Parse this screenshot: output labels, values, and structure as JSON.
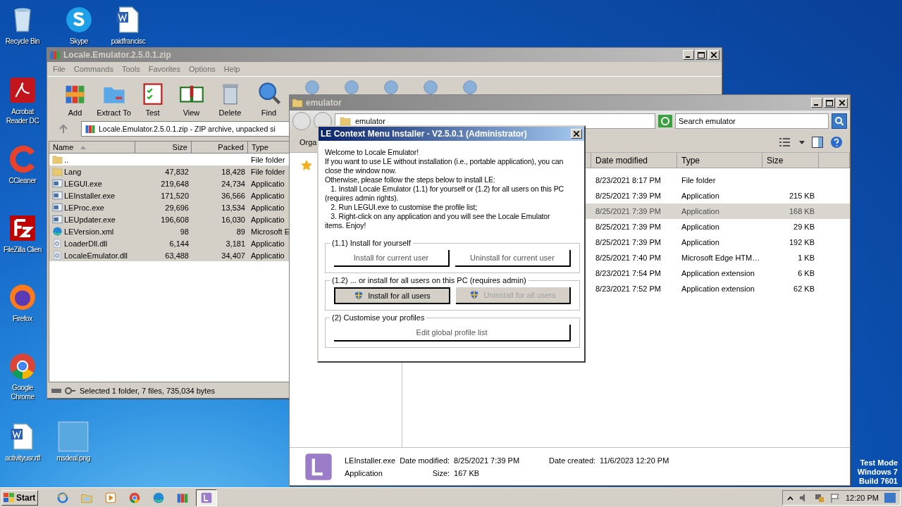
{
  "desktop_icons": [
    {
      "label": "Recycle Bin",
      "kind": "recycle"
    },
    {
      "label": "Skype",
      "kind": "skype"
    },
    {
      "label": "paidfrancisc",
      "kind": "word"
    },
    {
      "label": "Acrobat Reader DC",
      "kind": "acrobat"
    },
    {
      "label": "CCleaner",
      "kind": "ccleaner"
    },
    {
      "label": "FileZilla Clien",
      "kind": "filezilla"
    },
    {
      "label": "Firefox",
      "kind": "firefox"
    },
    {
      "label": "Google Chrome",
      "kind": "chrome"
    },
    {
      "label": "activityusr.rtf",
      "kind": "word"
    },
    {
      "label": "msdeal.png",
      "kind": "blank"
    }
  ],
  "winrar": {
    "title": "Locale.Emulator.2.5.0.1.zip",
    "menu": [
      "File",
      "Commands",
      "Tools",
      "Favorites",
      "Options",
      "Help"
    ],
    "toolbar": [
      {
        "label": "Add",
        "kind": "add"
      },
      {
        "label": "Extract To",
        "kind": "extract"
      },
      {
        "label": "Test",
        "kind": "test"
      },
      {
        "label": "View",
        "kind": "view"
      },
      {
        "label": "Delete",
        "kind": "delete"
      },
      {
        "label": "Find",
        "kind": "find"
      }
    ],
    "address": "Locale.Emulator.2.5.0.1.zip - ZIP archive, unpacked si",
    "columns": [
      "Name",
      "Size",
      "Packed",
      "Type"
    ],
    "rows": [
      {
        "name": "..",
        "size": "",
        "packed": "",
        "type": "File folder",
        "kind": "folder",
        "selected": false
      },
      {
        "name": "Lang",
        "size": "47,832",
        "packed": "18,428",
        "type": "File folder",
        "kind": "folder",
        "selected": true
      },
      {
        "name": "LEGUI.exe",
        "size": "219,648",
        "packed": "24,734",
        "type": "Applicatio",
        "kind": "exe",
        "selected": true
      },
      {
        "name": "LEInstaller.exe",
        "size": "171,520",
        "packed": "36,566",
        "type": "Applicatio",
        "kind": "exe",
        "selected": true
      },
      {
        "name": "LEProc.exe",
        "size": "29,696",
        "packed": "13,534",
        "type": "Applicatio",
        "kind": "exe",
        "selected": true
      },
      {
        "name": "LEUpdater.exe",
        "size": "196,608",
        "packed": "16,030",
        "type": "Applicatio",
        "kind": "exe",
        "selected": true
      },
      {
        "name": "LEVersion.xml",
        "size": "98",
        "packed": "89",
        "type": "Microsoft E",
        "kind": "edge",
        "selected": true
      },
      {
        "name": "LoaderDll.dll",
        "size": "6,144",
        "packed": "3,181",
        "type": "Applicatio",
        "kind": "dll",
        "selected": true
      },
      {
        "name": "LocaleEmulator.dll",
        "size": "63,488",
        "packed": "34,407",
        "type": "Applicatio",
        "kind": "dll",
        "selected": true
      }
    ],
    "status": "Selected 1 folder, 7 files, 735,034 bytes"
  },
  "explorer": {
    "title": "emulator",
    "breadcrumb": "emulator",
    "search": {
      "placeholder": "Search emulator"
    },
    "toolbar_label": "Orga",
    "columns": [
      "Date modified",
      "Type",
      "Size"
    ],
    "rows": [
      {
        "date": "8/23/2021 8:17 PM",
        "type": "File folder",
        "size": "",
        "selected": false
      },
      {
        "date": "8/25/2021 7:39 PM",
        "type": "Application",
        "size": "215 KB",
        "selected": false
      },
      {
        "date": "8/25/2021 7:39 PM",
        "type": "Application",
        "size": "168 KB",
        "selected": true
      },
      {
        "date": "8/25/2021 7:39 PM",
        "type": "Application",
        "size": "29 KB",
        "selected": false
      },
      {
        "date": "8/25/2021 7:39 PM",
        "type": "Application",
        "size": "192 KB",
        "selected": false
      },
      {
        "date": "8/25/2021 7:40 PM",
        "type": "Microsoft Edge HTM…",
        "size": "1 KB",
        "selected": false
      },
      {
        "date": "8/23/2021 7:54 PM",
        "type": "Application extension",
        "size": "6 KB",
        "selected": false
      },
      {
        "date": "8/23/2021 7:52 PM",
        "type": "Application extension",
        "size": "62 KB",
        "selected": false
      }
    ],
    "details": {
      "name": "LEInstaller.exe",
      "type": "Application",
      "modified_label": "Date modified:",
      "modified": "8/25/2021 7:39 PM",
      "size_label": "Size:",
      "size": "167 KB",
      "created_label": "Date created:",
      "created": "11/6/2023 12:20 PM"
    }
  },
  "dialog": {
    "title": "LE Context Menu Installer - V2.5.0.1 (Administrator)",
    "lines": [
      "Welcome to Locale Emulator!",
      "If you want to use LE without installation (i.e., portable application), you can",
      "close the window now.",
      "Otherwise, please follow the steps below to install LE:",
      "   1. Install Locale Emulator (1.1) for yourself or (1.2) for all users on this PC",
      "(requires admin rights).",
      "   2. Run LEGUI.exe to customise the profile list;",
      "   3. Right-click on any application and you will see the Locale Emulator",
      "items. Enjoy!"
    ],
    "groups": [
      {
        "legend": "(1.1) Install for yourself",
        "buttons": [
          {
            "label": "Install for current user",
            "shield": false,
            "disabled": false,
            "default": false
          },
          {
            "label": "Uninstall for current user",
            "shield": false,
            "disabled": false,
            "default": false
          }
        ]
      },
      {
        "legend": "(1.2) ... or install for all users on this PC (requires admin)",
        "buttons": [
          {
            "label": "Install for all users",
            "shield": true,
            "disabled": false,
            "default": true
          },
          {
            "label": "Uninstall for all users",
            "shield": true,
            "disabled": true,
            "default": false
          }
        ]
      },
      {
        "legend": "(2) Customise your profiles",
        "buttons": [
          {
            "label": "Edit global profile list",
            "shield": false,
            "disabled": false,
            "default": false
          }
        ]
      }
    ]
  },
  "os_notice": [
    "Test Mode",
    "Windows 7",
    "Build 7601"
  ],
  "taskbar": {
    "start": "Start",
    "apps": [
      {
        "kind": "ie",
        "active": false
      },
      {
        "kind": "explorer",
        "active": false
      },
      {
        "kind": "media",
        "active": false
      },
      {
        "kind": "chrome",
        "active": false
      },
      {
        "kind": "edge",
        "active": false
      },
      {
        "kind": "winrar",
        "active": false
      },
      {
        "kind": "le",
        "active": true
      }
    ],
    "time": "12:20 PM"
  }
}
